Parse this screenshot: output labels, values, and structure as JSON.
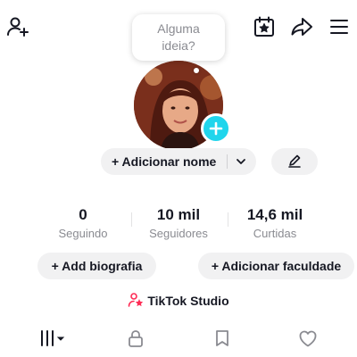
{
  "note": {
    "text": "Alguma\nideia?"
  },
  "profile": {
    "add_name_label": "+ Adicionar nome",
    "stats": [
      {
        "value": "0",
        "label": "Seguindo"
      },
      {
        "value": "10 mil",
        "label": "Seguidores"
      },
      {
        "value": "14,6 mil",
        "label": "Curtidas"
      }
    ],
    "add_bio_label": "+ Add biografia",
    "add_college_label": "+ Adicionar faculdade",
    "studio_label": "TikTok Studio"
  },
  "colors": {
    "accent": "#20d5ec",
    "studio_icon": "#fe2c55",
    "text": "#161823",
    "muted": "#8a8b91",
    "pill_bg": "#f1f1f2"
  },
  "icons": {
    "top": [
      "add-friend-icon",
      "calendar-star-icon",
      "share-arrow-icon",
      "hamburger-menu-icon"
    ],
    "tabs": [
      "videos-grid-icon",
      "lock-icon",
      "bookmark-icon",
      "heart-icon"
    ]
  }
}
